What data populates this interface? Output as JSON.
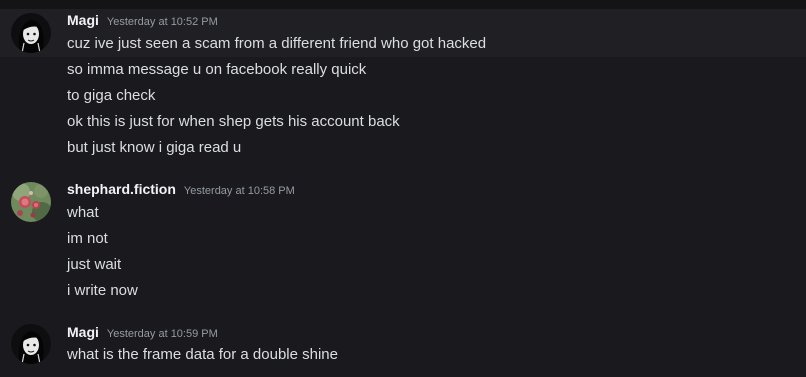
{
  "messages": [
    {
      "author": "Magi",
      "timestamp": "Yesterday at 10:52 PM",
      "lines": [
        "cuz ive just seen a scam from a different friend who got hacked",
        "so imma message u on facebook really quick",
        "to giga check",
        "ok this is just for when shep gets his account back",
        "but just know i giga read u"
      ]
    },
    {
      "author": "shephard.fiction",
      "timestamp": "Yesterday at 10:58 PM",
      "lines": [
        "what",
        "im not",
        "just wait",
        "i write now"
      ]
    },
    {
      "author": "Magi",
      "timestamp": "Yesterday at 10:59 PM",
      "lines": [
        "what is the frame data for a double shine"
      ]
    }
  ],
  "colors": {
    "background": "#1a1a1e",
    "hover_row": "#202024",
    "username": "#f2f3f5",
    "timestamp": "#949ba4",
    "message_text": "#dbdee1"
  }
}
